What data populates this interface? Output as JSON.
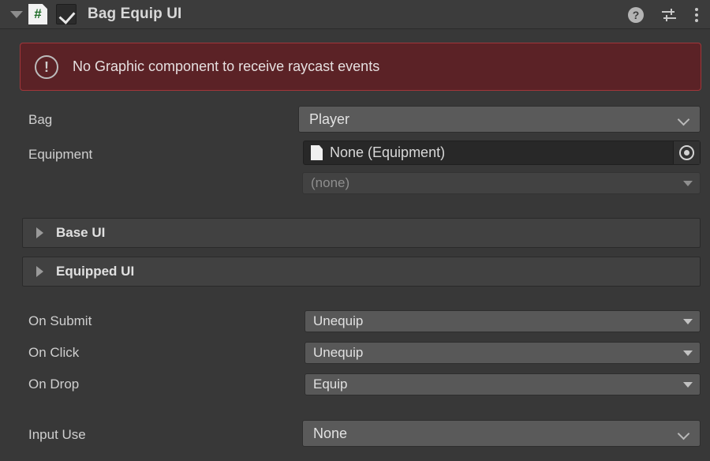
{
  "header": {
    "title": "Bag Equip UI",
    "foldout_arrow": "triangle-down",
    "script_icon_glyph": "#",
    "enabled": true,
    "help_label": "?",
    "icons": {
      "help": "help-icon",
      "preset": "preset-icon",
      "menu": "kebab-menu-icon"
    }
  },
  "error": {
    "icon": "!",
    "message": "No Graphic component to receive raycast events"
  },
  "properties": {
    "bag": {
      "label": "Bag",
      "value": "Player"
    },
    "equipment": {
      "label": "Equipment",
      "value": "None (Equipment)",
      "sub_value": "(none)"
    },
    "on_submit": {
      "label": "On Submit",
      "value": "Unequip"
    },
    "on_click": {
      "label": "On Click",
      "value": "Unequip"
    },
    "on_drop": {
      "label": "On Drop",
      "value": "Equip"
    },
    "input_use": {
      "label": "Input Use",
      "value": "None"
    }
  },
  "foldouts": [
    {
      "label": "Base UI",
      "expanded": false
    },
    {
      "label": "Equipped UI",
      "expanded": false
    }
  ],
  "colors": {
    "background": "#383838",
    "header_background": "#3c3c3c",
    "error_background": "#5b2226",
    "error_border": "#a1363a",
    "field_light": "#5a5a5a",
    "field_dark": "#282828",
    "script_icon_accent": "#1d6b26"
  }
}
